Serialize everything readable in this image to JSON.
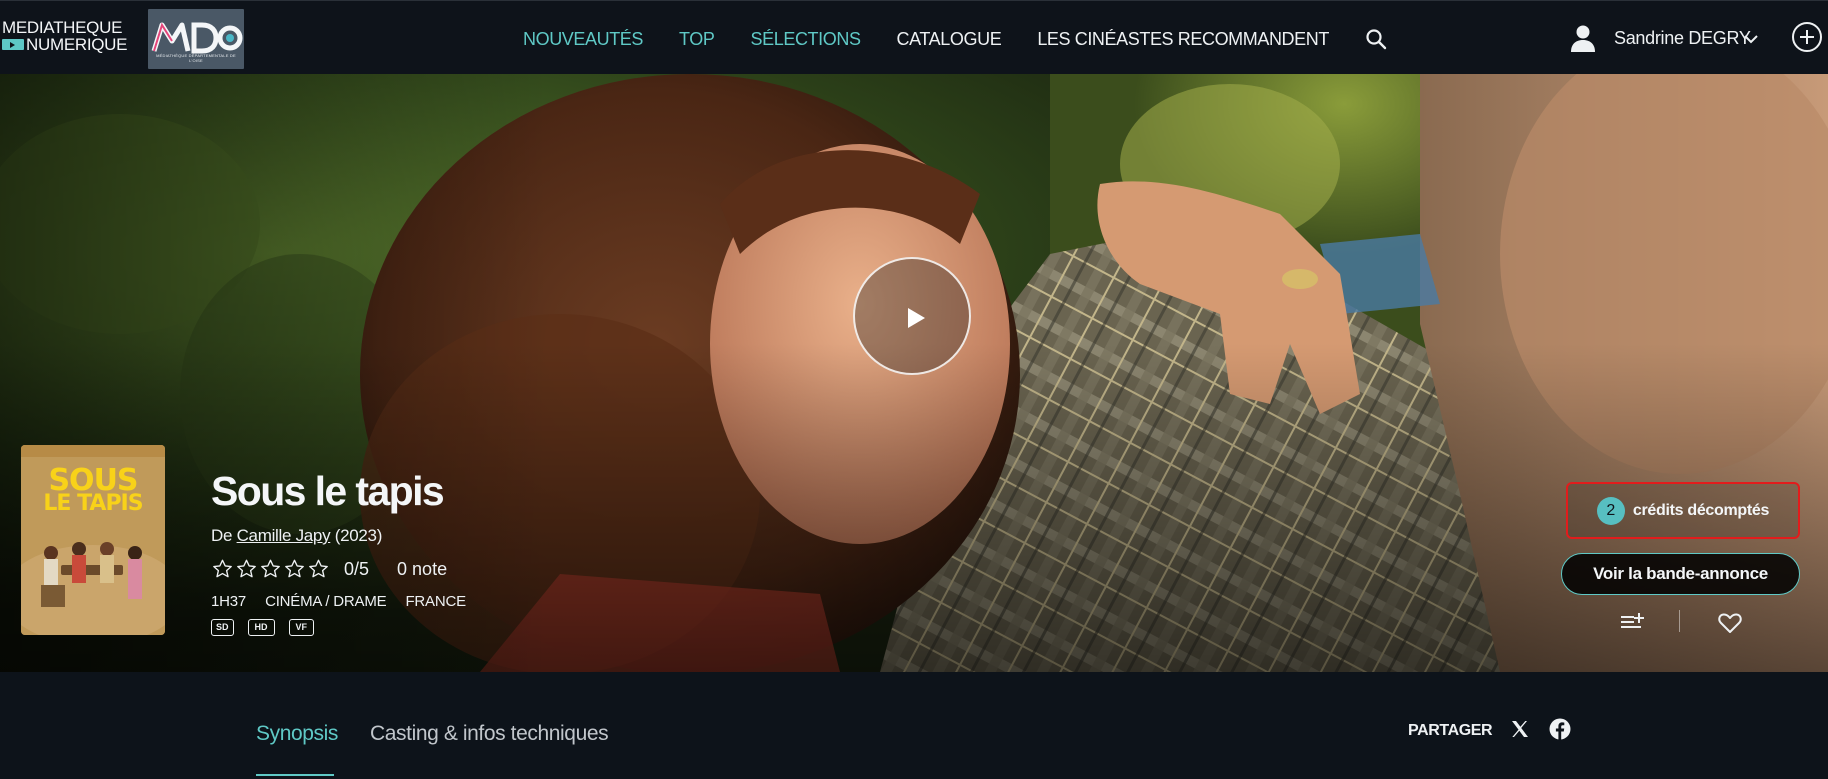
{
  "brand": {
    "logo_line1": "MEDIATHEQUE",
    "logo_line2": "NUMERIQUE",
    "partner_logo_text": "MDO",
    "partner_logo_subtitle": "MÉDIATHÈQUE DÉPARTEMENTALE DE L'OISE"
  },
  "nav": {
    "items": [
      {
        "label": "NOUVEAUTÉS",
        "active": true
      },
      {
        "label": "TOP",
        "active": true
      },
      {
        "label": "SÉLECTIONS",
        "active": true
      },
      {
        "label": "CATALOGUE",
        "active": false
      },
      {
        "label": "LES CINÉASTES RECOMMANDENT",
        "active": false
      }
    ],
    "search_icon": "search-icon"
  },
  "user": {
    "name": "Sandrine DEGRY",
    "avatar_icon": "user-icon",
    "menu_icon": "chevron-down-icon",
    "add_icon": "plus-circle-icon"
  },
  "film": {
    "title": "Sous le tapis",
    "by_prefix": "De",
    "director": "Camille Japy",
    "year": "(2023)",
    "rating_stars": 0,
    "rating_max": 5,
    "rating_text": "0/5",
    "notes_text": "0 note",
    "duration": "1H37",
    "genre": "CINÉMA / DRAME",
    "country": "FRANCE",
    "badges": [
      "SD",
      "HD",
      "VF"
    ],
    "poster_title_line1": "SOUS",
    "poster_title_line2": "LE TAPIS"
  },
  "actions": {
    "credits_count": "2",
    "credits_label": "crédits décomptés",
    "trailer_label": "Voir la bande-annonce",
    "playlist_icon": "playlist-add-icon",
    "favorite_icon": "heart-icon",
    "play_icon": "play-icon"
  },
  "tabs": {
    "items": [
      {
        "label": "Synopsis",
        "active": true
      },
      {
        "label": "Casting & infos techniques",
        "active": false
      }
    ],
    "share_label": "PARTAGER",
    "share_icons": [
      "x-icon",
      "facebook-icon"
    ]
  },
  "colors": {
    "accent": "#5fc9c6",
    "background": "#0e131a",
    "credits_border": "#e21c1c",
    "credits_badge": "#57bfc1"
  }
}
